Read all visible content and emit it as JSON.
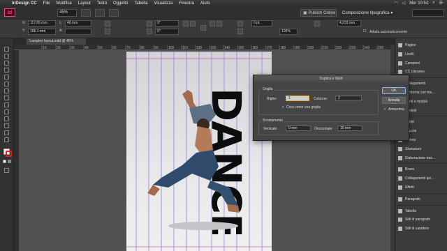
{
  "menubar": {
    "app": "InDesign CC",
    "items": [
      "File",
      "Modifica",
      "Layout",
      "Testo",
      "Oggetto",
      "Tabella",
      "Visualizza",
      "Finestra",
      "Aiuto"
    ],
    "clock": "Mer 10:54"
  },
  "appbar": {
    "logo": "Id",
    "zoom": "45%",
    "publish": "Publish Online",
    "workspace": "Composizione tipografica"
  },
  "control": {
    "x": "117,65 mm",
    "y": "165,1 mm",
    "w": "48 mm",
    "h": "",
    "angle": "0°",
    "shear": "0°",
    "stroke": "0 pt",
    "percent": "100%",
    "size": "4,233 mm",
    "autofit": "Adatta automaticamente"
  },
  "document_tab": "*complex layout.indd @ 45%",
  "ruler_marks": [
    "10",
    "20",
    "30",
    "40",
    "50",
    "60",
    "70",
    "80",
    "90",
    "100",
    "110",
    "120",
    "130",
    "140",
    "150",
    "160",
    "170",
    "180",
    "190",
    "200",
    "210",
    "220",
    "230",
    "240",
    "250"
  ],
  "page": {
    "headline": "DANCE"
  },
  "dialog": {
    "title": "Duplica e ripeti",
    "grid_section": "Griglia",
    "rows_label": "Righe:",
    "rows_value": "1",
    "cols_label": "Colonne:",
    "cols_value": "2",
    "create_grid": "Crea come una griglia",
    "offset_section": "Scostamento",
    "vertical_label": "Verticale:",
    "vertical_value": "0 mm",
    "horizontal_label": "Orizzontale:",
    "horizontal_value": "10 mm",
    "ok": "OK",
    "cancel": "Annulla",
    "preview": "Anteprima"
  },
  "panel": {
    "items": [
      {
        "label": "Pagine",
        "icon": "pages-icon"
      },
      {
        "label": "Livelli",
        "icon": "layers-icon"
      },
      {
        "label": "Campioni",
        "icon": "swatches-icon"
      },
      {
        "label": "CC Libraries",
        "icon": "libraries-icon"
      },
      {
        "label": "Collegamenti",
        "icon": "links-icon"
      },
      {
        "label": "Contorna con tes…",
        "icon": "text-wrap-icon"
      },
      {
        "label": "Punti e moduli",
        "icon": "pts-icon"
      },
      {
        "label": "Simboli",
        "icon": "symbols-icon"
      },
      {
        "label": "Script",
        "icon": "scripts-icon"
      },
      {
        "label": "Traccia",
        "icon": "stroke-icon"
      },
      {
        "label": "Allinea",
        "icon": "align-icon"
      },
      {
        "label": "Sfumatura",
        "icon": "gradient-icon"
      },
      {
        "label": "Elaborazione tras…",
        "icon": "pathfinder-icon"
      },
      {
        "label": "Brano",
        "icon": "story-icon"
      },
      {
        "label": "Collegamenti ipe…",
        "icon": "hyperlinks-icon"
      },
      {
        "label": "Effetti",
        "icon": "effects-icon"
      },
      {
        "label": "Paragrafo",
        "icon": "paragraph-icon"
      },
      {
        "label": "Tabella",
        "icon": "table-icon"
      },
      {
        "label": "Stili di paragrafo",
        "icon": "para-styles-icon"
      },
      {
        "label": "Stili di carattere",
        "icon": "char-styles-icon"
      }
    ]
  },
  "colors": {
    "accent": "#ff3c8e",
    "panel": "#3b3b3b",
    "canvas": "#515151"
  }
}
